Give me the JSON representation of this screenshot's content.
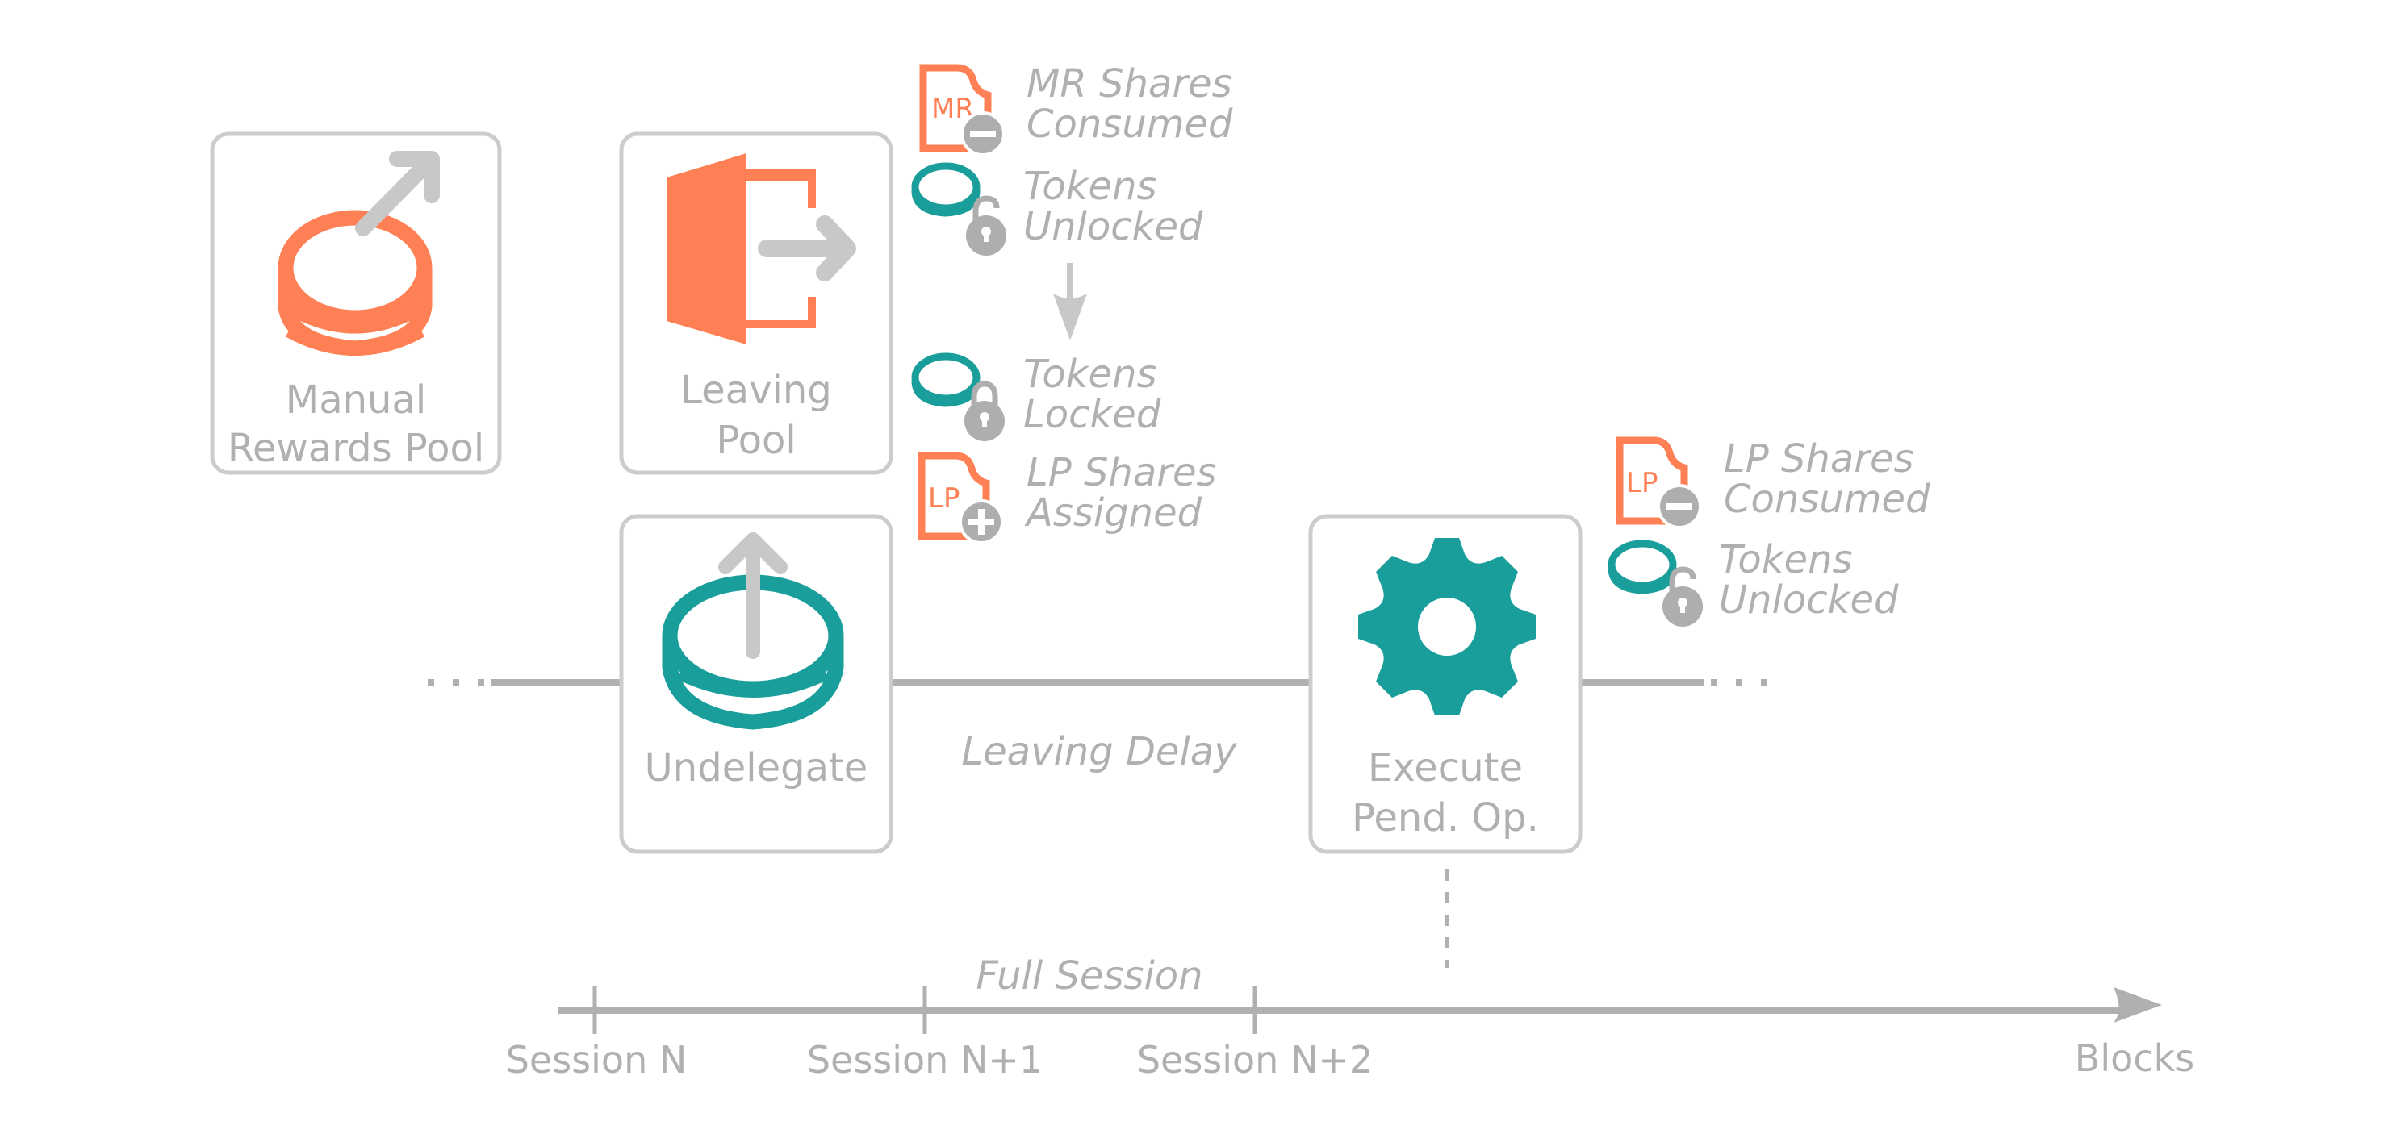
{
  "colors": {
    "orange": "#ff8055",
    "teal": "#1a9e9b",
    "gray_text": "#b0b0b0",
    "gray_border": "#cccccc",
    "gray_arrow": "#c8c8c8",
    "gray_badge": "#aeaeae"
  },
  "steps": {
    "manual_rewards_pool": {
      "line1": "Manual",
      "line2": "Rewards Pool",
      "icon": "coin-stack-out-icon"
    },
    "leaving_pool": {
      "line1": "Leaving",
      "line2": "Pool",
      "icon": "exit-door-icon"
    },
    "undelegate": {
      "label": "Undelegate",
      "icon": "coin-withdraw-icon"
    },
    "execute": {
      "line1": "Execute",
      "line2": "Pend. Op.",
      "icon": "gear-icon"
    }
  },
  "annotations": {
    "mr_shares_consumed": {
      "badge": "MR",
      "line1": "MR Shares",
      "line2": "Consumed",
      "icon": "share-document-minus-icon"
    },
    "tokens_unlocked_1": {
      "line1": "Tokens",
      "line2": "Unlocked",
      "icon": "token-unlocked-icon"
    },
    "tokens_locked": {
      "line1": "Tokens",
      "line2": "Locked",
      "icon": "token-locked-icon"
    },
    "lp_shares_assigned": {
      "badge": "LP",
      "line1": "LP Shares",
      "line2": "Assigned",
      "icon": "share-document-plus-icon"
    },
    "lp_shares_consumed": {
      "badge": "LP",
      "line1": "LP Shares",
      "line2": "Consumed",
      "icon": "share-document-minus-icon"
    },
    "tokens_unlocked_2": {
      "line1": "Tokens",
      "line2": "Unlocked",
      "icon": "token-unlocked-icon"
    }
  },
  "timeline": {
    "leaving_delay": "Leaving Delay",
    "full_session": "Full Session"
  },
  "axis": {
    "ticks": [
      "Session N",
      "Session N+1",
      "Session N+2"
    ],
    "end_label": "Blocks"
  }
}
